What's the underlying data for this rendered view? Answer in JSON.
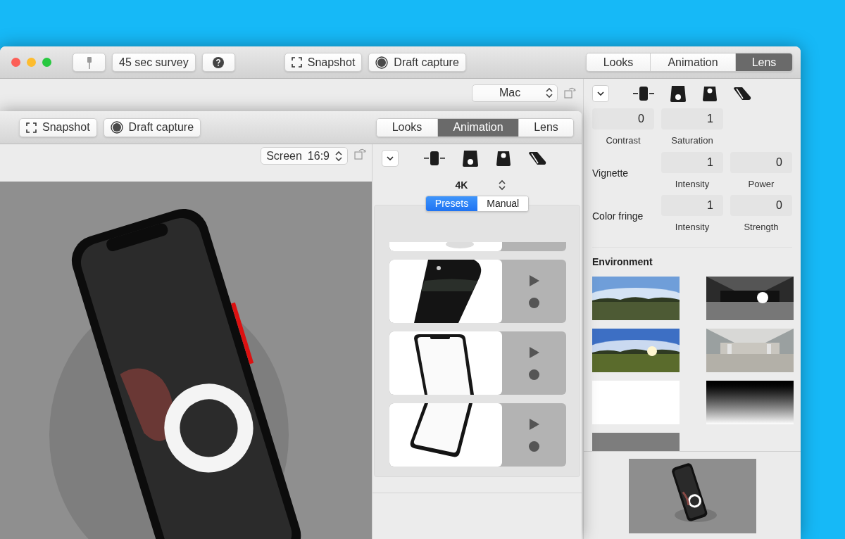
{
  "back_window": {
    "toolbar_buttons": [
      {
        "kind": "plug"
      },
      {
        "kind": "text",
        "label": "45 sec survey"
      },
      {
        "kind": "help"
      }
    ],
    "capture_buttons": [
      {
        "kind": "snapshot",
        "label": "Snapshot"
      },
      {
        "kind": "draft",
        "label": "Draft capture"
      }
    ],
    "tabs": [
      {
        "label": "Looks",
        "selected": false
      },
      {
        "label": "Animation",
        "selected": false
      },
      {
        "label": "Lens",
        "selected": true
      }
    ],
    "device_select": {
      "value": "Mac"
    },
    "lens_panel": {
      "rows": [
        {
          "fields": [
            {
              "value": "0",
              "label": "Contrast"
            },
            {
              "value": "1",
              "label": "Saturation"
            }
          ]
        },
        {
          "label": "Vignette",
          "fields": [
            {
              "value": "1",
              "label": "Intensity"
            },
            {
              "value": "0",
              "label": "Power"
            }
          ]
        },
        {
          "label": "Color fringe",
          "fields": [
            {
              "value": "1",
              "label": "Intensity"
            },
            {
              "value": "0",
              "label": "Strength"
            }
          ]
        }
      ],
      "environment": {
        "title": "Environment",
        "thumbnails": [
          {
            "kind": "picture"
          },
          {
            "kind": "picture"
          },
          {
            "kind": "picture"
          },
          {
            "kind": "picture"
          },
          {
            "kind": "blank"
          },
          {
            "kind": "gradient"
          },
          {
            "kind": "grey"
          }
        ]
      },
      "preview": {
        "kind": "picture"
      }
    }
  },
  "front_window": {
    "capture_buttons": [
      {
        "kind": "snapshot",
        "label": "Snapshot"
      },
      {
        "kind": "draft",
        "label": "Draft capture"
      }
    ],
    "tabs": [
      {
        "label": "Looks",
        "selected": false
      },
      {
        "label": "Animation",
        "selected": true
      },
      {
        "label": "Lens",
        "selected": false
      }
    ],
    "screen_select": {
      "label": "Screen",
      "value": "16:9"
    },
    "canvas": {
      "kind": "picture"
    },
    "resolution": "4K",
    "mode_tabs": [
      {
        "label": "Presets",
        "selected": true
      },
      {
        "label": "Manual",
        "selected": false
      }
    ],
    "partial_preset": {
      "kind": "picture"
    },
    "presets": [
      {
        "kind": "picture"
      },
      {
        "kind": "picture"
      },
      {
        "kind": "picture"
      }
    ]
  }
}
